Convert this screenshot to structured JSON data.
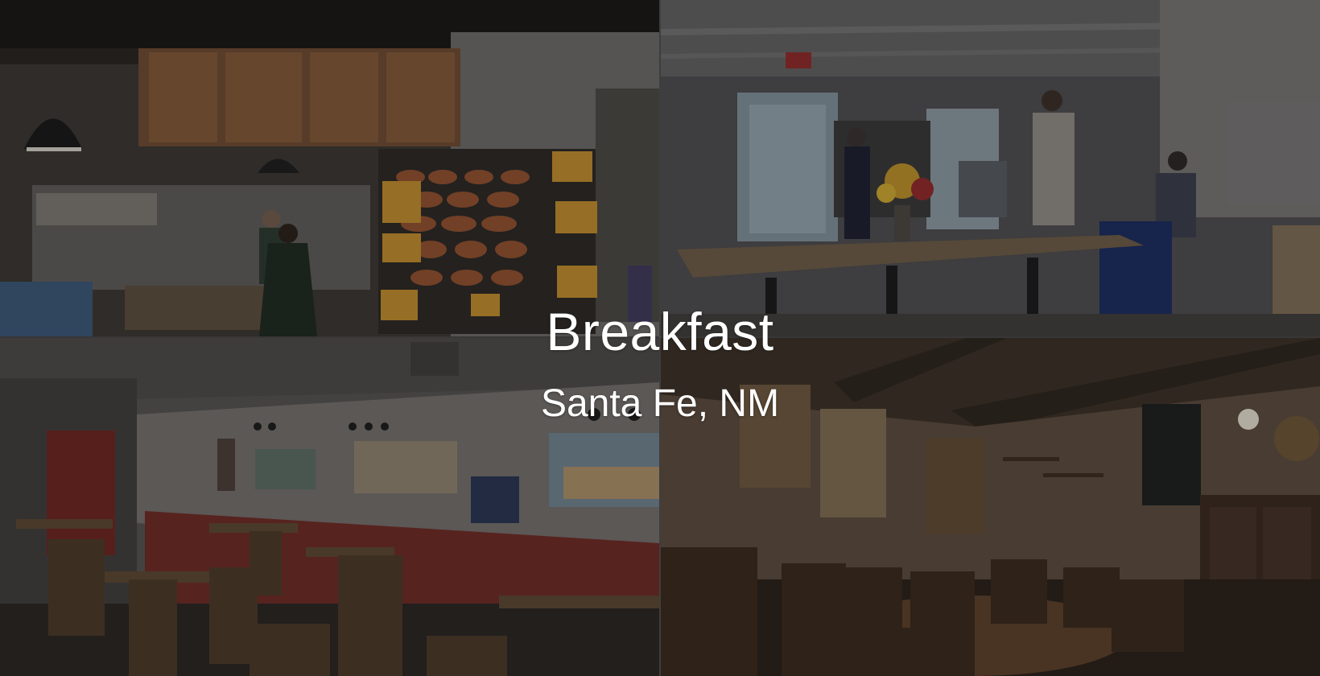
{
  "title": "Breakfast",
  "subtitle": "Santa Fe, NM",
  "tiles": [
    {
      "name": "bakery-counter-photo"
    },
    {
      "name": "cafe-dining-room-photo"
    },
    {
      "name": "diner-with-landscape-paintings-photo"
    },
    {
      "name": "rustic-dining-room-photo"
    }
  ],
  "colors": {
    "text": "#ffffff",
    "divider": "#7a7a7a"
  }
}
